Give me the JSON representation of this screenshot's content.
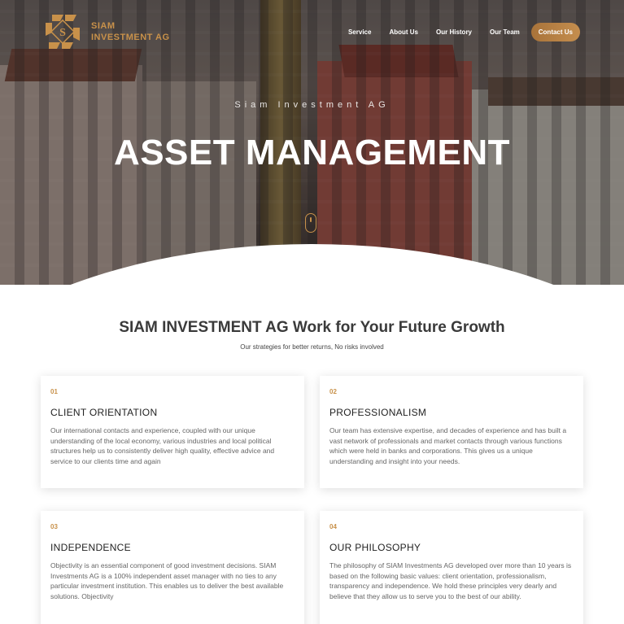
{
  "brand": {
    "line1": "SIAM",
    "line2": "INVESTMENT AG",
    "color": "#c8914a"
  },
  "nav": {
    "items": [
      "Service",
      "About Us",
      "Our History",
      "Our Team"
    ],
    "cta": "Contact Us"
  },
  "hero": {
    "subtitle": "Siam Investment AG",
    "title": "ASSET MANAGEMENT"
  },
  "section": {
    "title": "SIAM INVESTMENT AG Work for Your Future Growth",
    "subtitle": "Our strategies for better returns, No risks involved"
  },
  "cards": [
    {
      "num": "01",
      "title": "CLIENT ORIENTATION",
      "body": "Our international contacts and experience, coupled with our unique understanding of the local economy, various industries and local political structures help us to consistently deliver high quality, effective advice and service to our clients time and again"
    },
    {
      "num": "02",
      "title": "PROFESSIONALISM",
      "body": "Our team has extensive expertise, and decades of experience and has built a vast network of professionals and market contacts through various functions which were held in banks and corporations. This gives us a unique understanding and insight into your needs."
    },
    {
      "num": "03",
      "title": "INDEPENDENCE",
      "body": "Objectivity is an essential component of good investment decisions. SIAM Investments AG is a 100% independent asset manager with no ties to any particular investment institution. This enables us to deliver the best available solutions. Objectivity"
    },
    {
      "num": "04",
      "title": "OUR PHILOSOPHY",
      "body": "The philosophy of SIAM Investments AG developed over more than 10 years is based on the following basic values: client orientation, professionalism, transparency and independence. We hold these principles very dearly and believe that they allow us to serve you to the best of our ability."
    }
  ]
}
